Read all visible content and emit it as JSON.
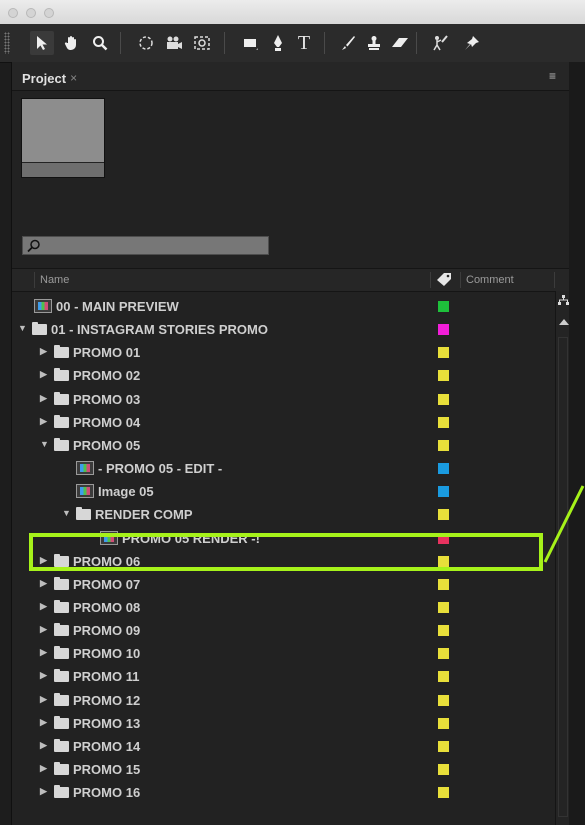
{
  "project_panel": {
    "tab_label": "Project",
    "tab_close": "×",
    "menu_icon": "≡"
  },
  "columns": {
    "name": "Name",
    "comment": "Comment"
  },
  "colors": {
    "green": "#1ec13b",
    "magenta": "#f21ed9",
    "yellow": "#e8df3a",
    "cyan": "#1a9be0",
    "red": "#e8325f",
    "highlight": "#a6f21a"
  },
  "items": [
    {
      "name": "00 - MAIN PREVIEW",
      "type": "comp",
      "indent": 0,
      "twirl": "none",
      "color": "green"
    },
    {
      "name": "01 - INSTAGRAM STORIES PROMO",
      "type": "folder",
      "indent": 0,
      "twirl": "open",
      "color": "magenta"
    },
    {
      "name": "PROMO 01",
      "type": "folder",
      "indent": 1,
      "twirl": "closed",
      "color": "yellow"
    },
    {
      "name": "PROMO 02",
      "type": "folder",
      "indent": 1,
      "twirl": "closed",
      "color": "yellow"
    },
    {
      "name": "PROMO 03",
      "type": "folder",
      "indent": 1,
      "twirl": "closed",
      "color": "yellow"
    },
    {
      "name": "PROMO 04",
      "type": "folder",
      "indent": 1,
      "twirl": "closed",
      "color": "yellow"
    },
    {
      "name": "PROMO 05",
      "type": "folder",
      "indent": 1,
      "twirl": "open",
      "color": "yellow"
    },
    {
      "name": "- PROMO 05 - EDIT -",
      "type": "comp",
      "indent": 2,
      "twirl": "none",
      "color": "cyan"
    },
    {
      "name": "Image 05",
      "type": "comp",
      "indent": 2,
      "twirl": "none",
      "color": "cyan"
    },
    {
      "name": "RENDER COMP",
      "type": "folder",
      "indent": 2,
      "twirl": "open",
      "color": "yellow"
    },
    {
      "name": "PROMO 05 RENDER -!",
      "type": "comp",
      "indent": 3,
      "twirl": "none",
      "color": "red"
    },
    {
      "name": "PROMO 06",
      "type": "folder",
      "indent": 1,
      "twirl": "closed",
      "color": "yellow"
    },
    {
      "name": "PROMO 07",
      "type": "folder",
      "indent": 1,
      "twirl": "closed",
      "color": "yellow"
    },
    {
      "name": "PROMO 08",
      "type": "folder",
      "indent": 1,
      "twirl": "closed",
      "color": "yellow"
    },
    {
      "name": "PROMO 09",
      "type": "folder",
      "indent": 1,
      "twirl": "closed",
      "color": "yellow"
    },
    {
      "name": "PROMO 10",
      "type": "folder",
      "indent": 1,
      "twirl": "closed",
      "color": "yellow"
    },
    {
      "name": "PROMO 11",
      "type": "folder",
      "indent": 1,
      "twirl": "closed",
      "color": "yellow"
    },
    {
      "name": "PROMO 12",
      "type": "folder",
      "indent": 1,
      "twirl": "closed",
      "color": "yellow"
    },
    {
      "name": "PROMO 13",
      "type": "folder",
      "indent": 1,
      "twirl": "closed",
      "color": "yellow"
    },
    {
      "name": "PROMO 14",
      "type": "folder",
      "indent": 1,
      "twirl": "closed",
      "color": "yellow"
    },
    {
      "name": "PROMO 15",
      "type": "folder",
      "indent": 1,
      "twirl": "closed",
      "color": "yellow"
    },
    {
      "name": "PROMO 16",
      "type": "folder",
      "indent": 1,
      "twirl": "closed",
      "color": "yellow"
    }
  ],
  "toolbar_tools": [
    "selection-tool-icon",
    "hand-tool-icon",
    "zoom-tool-icon",
    "rotation-tool-icon",
    "camera-tool-icon",
    "pan-behind-tool-icon",
    "rectangle-tool-icon",
    "pen-tool-icon",
    "type-tool-icon",
    "brush-tool-icon",
    "clone-stamp-tool-icon",
    "eraser-tool-icon",
    "roto-brush-tool-icon",
    "puppet-pin-tool-icon"
  ],
  "selected_item": "PROMO 05 RENDER -!"
}
